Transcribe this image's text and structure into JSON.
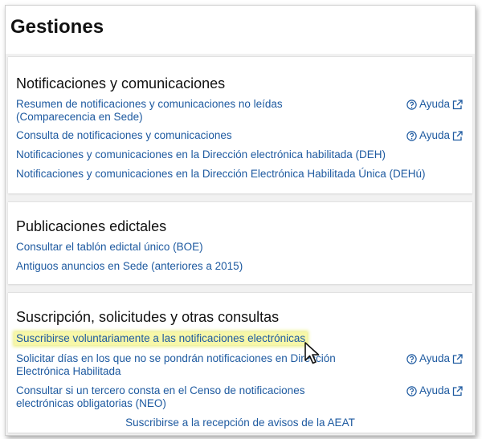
{
  "page": {
    "title": "Gestiones"
  },
  "sections": [
    {
      "title": "Notificaciones y comunicaciones",
      "links": [
        {
          "label": "Resumen de notificaciones y comunicaciones no leídas (Comparecencia en Sede)",
          "help": "Ayuda",
          "help_icon": "question-circle-icon",
          "external_icon": "external-link-icon"
        },
        {
          "label": "Consulta de notificaciones y comunicaciones",
          "help": "Ayuda",
          "help_icon": "question-circle-icon",
          "external_icon": "external-link-icon"
        },
        {
          "label": "Notificaciones y comunicaciones en la Dirección electrónica habilitada (DEH)"
        },
        {
          "label": "Notificaciones y comunicaciones en la Dirección Electrónica Habilitada Única (DEHú)"
        }
      ]
    },
    {
      "title": "Publicaciones edictales",
      "links": [
        {
          "label": "Consultar el tablón edictal único (BOE)"
        },
        {
          "label": "Antiguos anuncios en Sede (anteriores a 2015)"
        }
      ]
    },
    {
      "title": "Suscripción, solicitudes y otras consultas",
      "links": [
        {
          "label": "Suscribirse voluntariamente a las notificaciones electrónicas",
          "highlighted": true
        },
        {
          "label": "Solicitar días en los que no se pondrán notificaciones en Dirección Electrónica Habilitada",
          "help": "Ayuda",
          "help_icon": "question-circle-icon",
          "external_icon": "external-link-icon"
        },
        {
          "label": "Consultar si un tercero consta en el Censo de notificaciones electrónicas obligatorias (NEO)",
          "help": "Ayuda",
          "help_icon": "question-circle-icon",
          "external_icon": "external-link-icon"
        },
        {
          "label": "Suscribirse a la recepción de avisos de la AEAT"
        }
      ]
    }
  ],
  "colors": {
    "link": "#1e5aa0",
    "highlight": "#f7f7a8",
    "background": "#f1f1f1"
  },
  "cursor": {
    "icon": "mouse-pointer-icon"
  }
}
